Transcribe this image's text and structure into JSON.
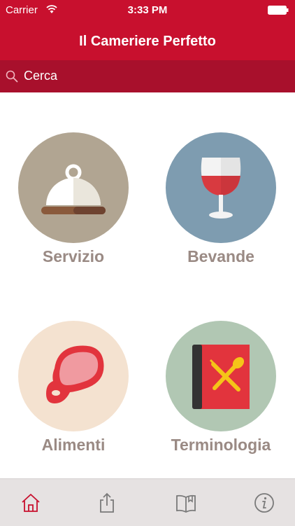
{
  "statusbar": {
    "carrier": "Carrier",
    "time": "3:33 PM"
  },
  "navbar": {
    "title": "Il Cameriere Perfetto"
  },
  "search": {
    "placeholder": "Cerca"
  },
  "categories": [
    {
      "label": "Servizio",
      "icon": "cloche-icon",
      "circle_color": "#b1a592"
    },
    {
      "label": "Bevande",
      "icon": "wine-glass-icon",
      "circle_color": "#7e9cb0"
    },
    {
      "label": "Alimenti",
      "icon": "meat-steak-icon",
      "circle_color": "#f4e2d0"
    },
    {
      "label": "Terminologia",
      "icon": "menu-book-icon",
      "circle_color": "#b1c7b3"
    }
  ],
  "tabbar": {
    "items": [
      {
        "icon": "home-icon",
        "active": true
      },
      {
        "icon": "share-icon",
        "active": false
      },
      {
        "icon": "book-icon",
        "active": false
      },
      {
        "icon": "info-icon",
        "active": false
      }
    ]
  },
  "colors": {
    "brand": "#c8102e",
    "brand_dark": "#a8102c",
    "label": "#9a8a84",
    "tab_active": "#c8102e",
    "tab_inactive": "#7a7a7a"
  }
}
